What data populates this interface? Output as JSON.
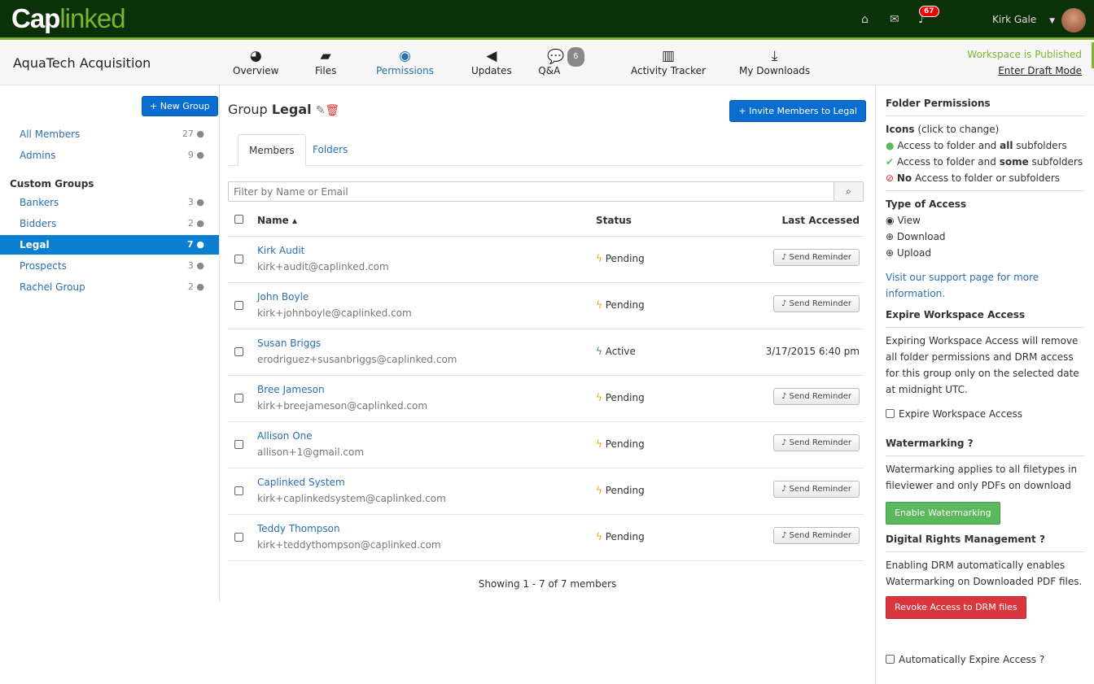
{
  "brand": {
    "logo_cap": "Cap",
    "logo_linked": "linked"
  },
  "topbar": {
    "notifications": "67",
    "user": "Kirk Gale"
  },
  "workspace": {
    "title": "AquaTech Acquisition",
    "published": "Workspace is Published",
    "draft_link": "Enter Draft Mode"
  },
  "nav": [
    {
      "label": "Overview"
    },
    {
      "label": "Files"
    },
    {
      "label": "Permissions"
    },
    {
      "label": "Updates"
    },
    {
      "label": "Q&A",
      "count": "6"
    },
    {
      "label": "Activity Tracker"
    },
    {
      "label": "My Downloads"
    }
  ],
  "sidebar": {
    "new_group": "+ New Group",
    "custom_groups": "Custom Groups",
    "top": [
      {
        "label": "All Members",
        "count": "27"
      },
      {
        "label": "Admins",
        "count": "9"
      }
    ],
    "groups": [
      {
        "label": "Bankers",
        "count": "3"
      },
      {
        "label": "Bidders",
        "count": "2"
      },
      {
        "label": "Legal",
        "count": "7"
      },
      {
        "label": "Prospects",
        "count": "3"
      },
      {
        "label": "Rachel Group",
        "count": "2"
      }
    ]
  },
  "main": {
    "group_prefix": "Group",
    "group_name": "Legal",
    "invite": "+ Invite Members to Legal",
    "tabs": [
      "Members",
      "Folders"
    ],
    "filter_placeholder": "Filter by Name or Email",
    "columns": {
      "name": "Name ▴",
      "status": "Status",
      "last": "Last Accessed"
    },
    "members": [
      {
        "name": "Kirk Audit",
        "email": "kirk+audit@caplinked.com",
        "status": "Pending",
        "last": "",
        "action": "Send Reminder"
      },
      {
        "name": "John Boyle",
        "email": "kirk+johnboyle@caplinked.com",
        "status": "Pending",
        "last": "",
        "action": "Send Reminder"
      },
      {
        "name": "Susan Briggs",
        "email": "erodriguez+susanbriggs@caplinked.com",
        "status": "Active",
        "last": "3/17/2015 6:40 pm",
        "action": ""
      },
      {
        "name": "Bree Jameson",
        "email": "kirk+breejameson@caplinked.com",
        "status": "Pending",
        "last": "",
        "action": "Send Reminder"
      },
      {
        "name": "Allison One",
        "email": "allison+1@gmail.com",
        "status": "Pending",
        "last": "",
        "action": "Send Reminder"
      },
      {
        "name": "Caplinked System",
        "email": "kirk+caplinkedsystem@caplinked.com",
        "status": "Pending",
        "last": "",
        "action": "Send Reminder"
      },
      {
        "name": "Teddy Thompson",
        "email": "kirk+teddythompson@caplinked.com",
        "status": "Pending",
        "last": "",
        "action": "Send Reminder"
      }
    ],
    "showing": "Showing 1 - 7 of 7 members"
  },
  "panel": {
    "title": "Folder Permissions",
    "icons_label": "Icons",
    "icons_hint": "(click to change)",
    "all_a": "Access to folder and ",
    "all_b": "all",
    "all_c": " subfolders",
    "some_a": "Access to folder and ",
    "some_b": "some",
    "some_c": " subfolders",
    "no_a": "No",
    "no_b": " Access to folder or subfolders",
    "type_title": "Type of Access",
    "view": "View",
    "download": "Download",
    "upload": "Upload",
    "support": "Visit our support page for more information.",
    "expire_title": "Expire Workspace Access",
    "expire_text": "Expiring Workspace Access will remove all folder permissions and DRM access for this group only on the selected date at midnight UTC.",
    "expire_cb": "Expire Workspace Access",
    "wm_title": "Watermarking",
    "wm_text": "Watermarking applies to all filetypes in fileviewer and only PDFs on download",
    "wm_btn": "Enable Watermarking",
    "drm_title": "Digital Rights Management",
    "drm_text": "Enabling DRM automatically enables Watermarking on Downloaded PDF files.",
    "drm_btn": "Revoke Access to DRM files",
    "auto_expire": "Automatically Expire Access"
  },
  "colors": {
    "topbar": "#0b3108",
    "accent_green": "#7ab335",
    "link": "#2a6fb0",
    "pending": "#f0a30a",
    "active": "#3a9a3a"
  }
}
